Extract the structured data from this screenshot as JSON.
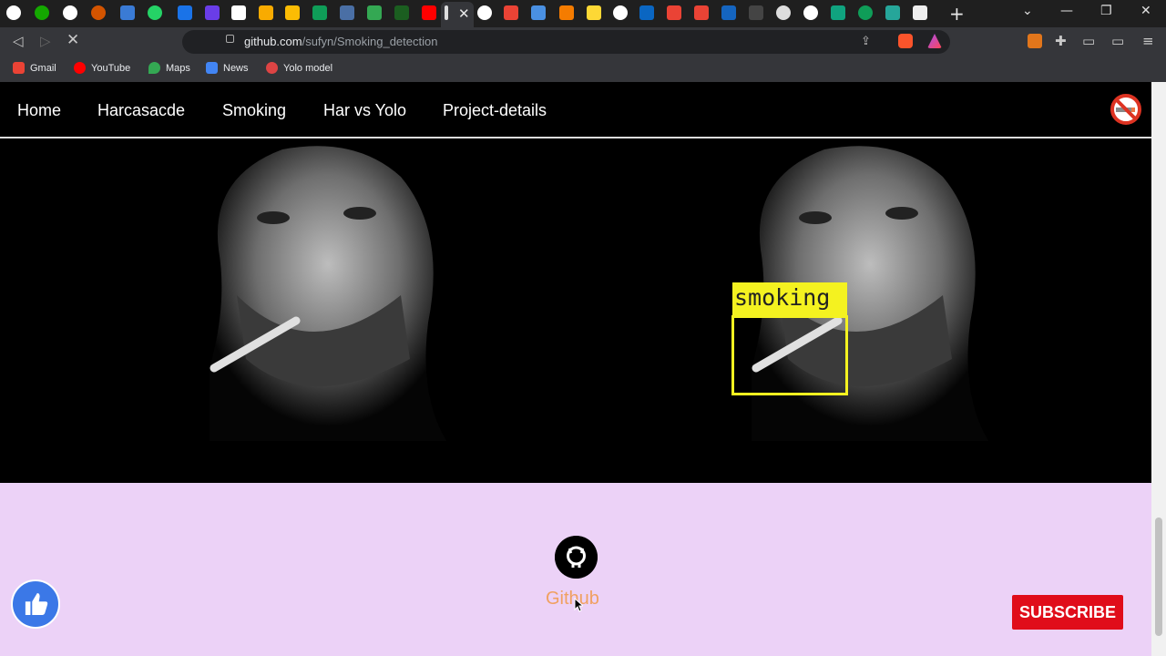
{
  "browser": {
    "url_domain": "github.com",
    "url_path": "/sufyn/Smoking_detection",
    "tab_close": "✕",
    "new_tab": "+",
    "window_controls": [
      "⌄",
      "—",
      "❐",
      "✕"
    ],
    "bookmarks": [
      {
        "label": "Gmail",
        "icon": "gmail-icon",
        "color": "#ea4335"
      },
      {
        "label": "YouTube",
        "icon": "youtube-icon",
        "color": "#ff0000"
      },
      {
        "label": "Maps",
        "icon": "maps-icon",
        "color": "#34a853"
      },
      {
        "label": "News",
        "icon": "news-icon",
        "color": "#4285f4"
      },
      {
        "label": "Yolo model",
        "icon": "yolo-icon",
        "color": "#d44"
      }
    ]
  },
  "site": {
    "nav": [
      "Home",
      "Harcasacde",
      "Smoking",
      "Har vs Yolo",
      "Project-details"
    ],
    "detection_label": "smoking",
    "footer_link": "Github"
  },
  "overlay": {
    "subscribe_label": "SUBSCRIBE"
  },
  "colors": {
    "footer_bg": "#ecd2f7",
    "github_link": "#f0a060",
    "detection_box": "#f4f220",
    "subscribe_bg": "#e00d1a"
  }
}
